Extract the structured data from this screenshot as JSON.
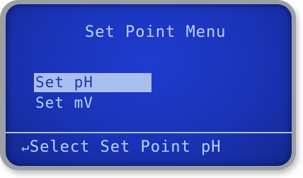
{
  "screen": {
    "title": "Set Point Menu",
    "menu_items": [
      {
        "label": "Set pH",
        "selected": true
      },
      {
        "label": "Set mV",
        "selected": false
      }
    ],
    "status": {
      "icon": "enter-arrow-icon",
      "text": "Select Set Point pH"
    }
  },
  "colors": {
    "lcd_background": "#1a33b6",
    "lcd_text": "#bcd0ff",
    "highlight": "#a9bff0",
    "bezel": "#9b9fa6"
  }
}
